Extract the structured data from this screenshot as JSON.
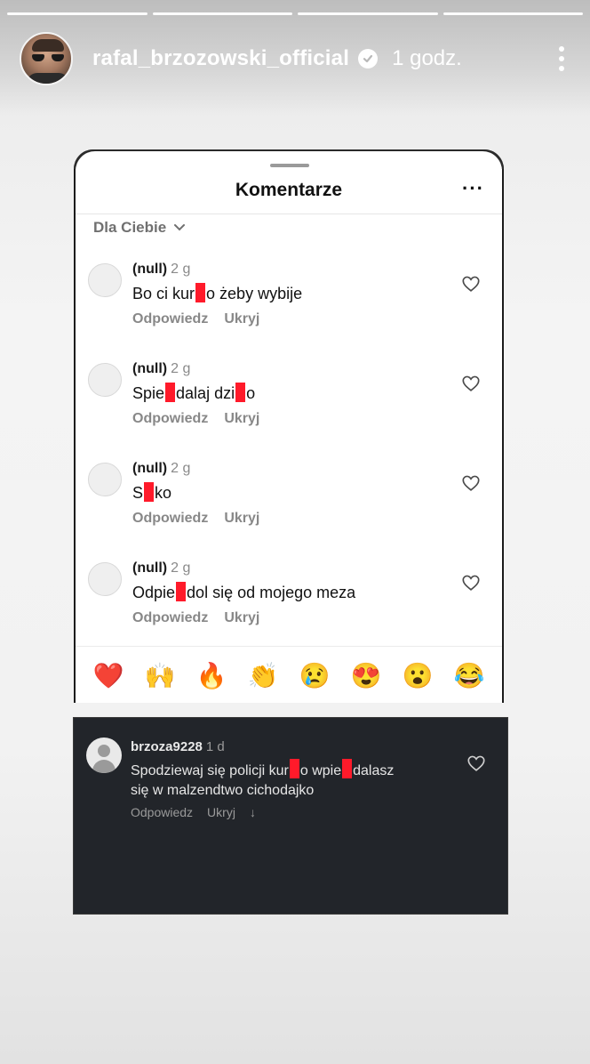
{
  "story": {
    "username": "rafal_brzozowski_official",
    "time": "1 godz.",
    "segments": 4
  },
  "sheet": {
    "title": "Komentarze",
    "more": "···",
    "filter": "Dla Ciebie"
  },
  "comments": [
    {
      "user": "(null)",
      "ago": "2 g",
      "pre": "Bo ci kur",
      "post": "o żeby wybije",
      "reply": "Odpowiedz",
      "hide": "Ukryj"
    },
    {
      "user": "(null)",
      "ago": "2 g",
      "pre": "Spie",
      "mid": "dalaj dzi",
      "post": "o",
      "reply": "Odpowiedz",
      "hide": "Ukryj"
    },
    {
      "user": "(null)",
      "ago": "2 g",
      "pre": "S",
      "post": "ko",
      "reply": "Odpowiedz",
      "hide": "Ukryj"
    },
    {
      "user": "(null)",
      "ago": "2 g",
      "pre": "Odpie",
      "post": "dol się od mojego meza",
      "reply": "Odpowiedz",
      "hide": "Ukryj"
    }
  ],
  "reactions": [
    "❤️",
    "🙌",
    "🔥",
    "👏",
    "😢",
    "😍",
    "😮",
    "😂"
  ],
  "dark_comment": {
    "user": "brzoza9228",
    "ago": "1 d",
    "pre": "Spodziewaj się policji kur",
    "mid": "o wpie",
    "post": "dalasz",
    "line2": "się w malzendtwo cichodajko",
    "reply": "Odpowiedz",
    "hide": "Ukryj",
    "arrow": "↓"
  },
  "colors": {
    "redaction": "#ff1a2a",
    "dark_card": "#22252a"
  }
}
